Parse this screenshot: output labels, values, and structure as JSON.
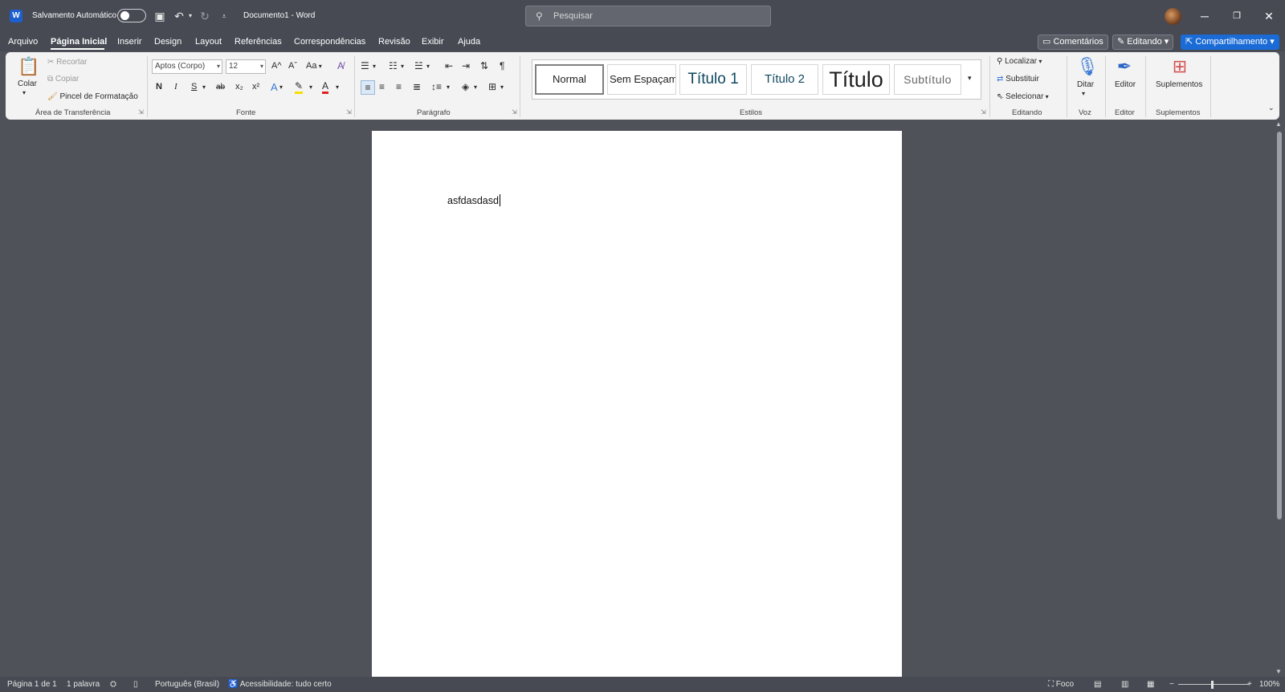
{
  "titlebar": {
    "logo": "W",
    "autosave_label": "Salvamento Automático",
    "document_title": "Documento1  -  Word",
    "search_placeholder": "Pesquisar"
  },
  "menu": {
    "items": [
      "Arquivo",
      "Página Inicial",
      "Inserir",
      "Design",
      "Layout",
      "Referências",
      "Correspondências",
      "Revisão",
      "Exibir",
      "Ajuda"
    ],
    "active": "Página Inicial",
    "comments_label": "Comentários",
    "editing_label": "Editando",
    "share_label": "Compartilhamento"
  },
  "ribbon": {
    "clipboard": {
      "paste": "Colar",
      "cut": "Recortar",
      "copy": "Copiar",
      "format_painter": "Pincel de Formatação",
      "group": "Área de Transferência"
    },
    "font": {
      "name": "Aptos (Corpo)",
      "size": "12",
      "change_case": "Aa",
      "bold": "N",
      "italic": "I",
      "underline": "S",
      "strike": "ab",
      "subscript": "x₂",
      "superscript": "x²",
      "grow": "A^",
      "shrink": "Aˇ",
      "group": "Fonte"
    },
    "paragraph": {
      "group": "Parágrafo",
      "pilcrow": "¶"
    },
    "styles": {
      "items": [
        "Normal",
        "Sem Espaçamento",
        "Título 1",
        "Título 2",
        "Título",
        "Subtítulo"
      ],
      "group": "Estilos"
    },
    "editing": {
      "find": "Localizar",
      "replace": "Substituir",
      "select": "Selecionar",
      "group": "Editando"
    },
    "voice": {
      "dictate": "Ditar",
      "group": "Voz"
    },
    "editor": {
      "label": "Editor",
      "group": "Editor"
    },
    "addins": {
      "label": "Suplementos",
      "group": "Suplementos"
    }
  },
  "document": {
    "body_text": "asfdasdasd"
  },
  "status": {
    "page": "Página 1 de 1",
    "words": "1 palavra",
    "language": "Português (Brasil)",
    "accessibility": "Acessibilidade: tudo certo",
    "focus": "Foco",
    "zoom": "100%"
  },
  "colors": {
    "titlebar_bg": "#474a53",
    "canvas_bg": "#50525a",
    "ribbon_bg": "#f3f3f3",
    "share_blue": "#1a6bd6",
    "heading_blue": "#0f4761",
    "font_color_red": "#e02020",
    "highlight_yellow": "#f5e000"
  }
}
